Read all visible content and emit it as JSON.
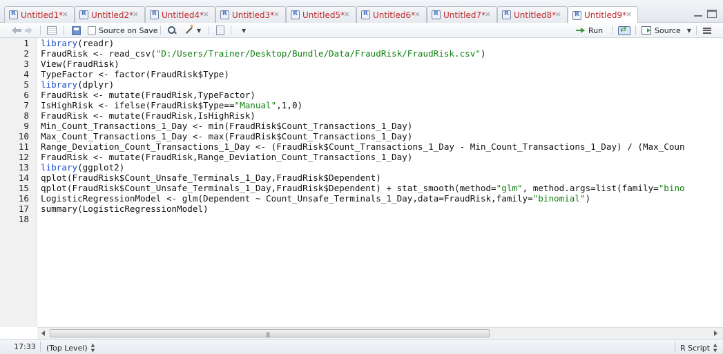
{
  "tabs": [
    {
      "label": "Untitled1*",
      "active": false
    },
    {
      "label": "Untitled2*",
      "active": false
    },
    {
      "label": "Untitled4*",
      "active": false
    },
    {
      "label": "Untitled3*",
      "active": false
    },
    {
      "label": "Untitled5*",
      "active": false
    },
    {
      "label": "Untitled6*",
      "active": false
    },
    {
      "label": "Untitled7*",
      "active": false
    },
    {
      "label": "Untitled8*",
      "active": false
    },
    {
      "label": "Untitled9*",
      "active": true
    }
  ],
  "toolbar": {
    "source_on_save_label": "Source on Save",
    "source_on_save_checked": false,
    "run_label": "Run",
    "source_label": "Source"
  },
  "editor": {
    "lines": [
      {
        "n": "1",
        "tokens": [
          {
            "t": "library",
            "c": "kw"
          },
          {
            "t": "(readr)"
          }
        ]
      },
      {
        "n": "2",
        "tokens": [
          {
            "t": "FraudRisk <- read_csv("
          },
          {
            "t": "\"D:/Users/Trainer/Desktop/Bundle/Data/FraudRisk/FraudRisk.csv\"",
            "c": "str"
          },
          {
            "t": ")"
          }
        ]
      },
      {
        "n": "3",
        "tokens": [
          {
            "t": "View(FraudRisk)"
          }
        ]
      },
      {
        "n": "4",
        "tokens": [
          {
            "t": "TypeFactor <- factor(FraudRisk$Type)"
          }
        ]
      },
      {
        "n": "5",
        "tokens": [
          {
            "t": "library",
            "c": "kw"
          },
          {
            "t": "(dplyr)"
          }
        ]
      },
      {
        "n": "6",
        "tokens": [
          {
            "t": "FraudRisk <- mutate(FraudRisk,TypeFactor)"
          }
        ]
      },
      {
        "n": "7",
        "tokens": [
          {
            "t": "IsHighRisk <- ifelse(FraudRisk$Type=="
          },
          {
            "t": "\"Manual\"",
            "c": "str"
          },
          {
            "t": ",1,0)"
          }
        ]
      },
      {
        "n": "8",
        "tokens": [
          {
            "t": "FraudRisk <- mutate(FraudRisk,IsHighRisk)"
          }
        ]
      },
      {
        "n": "9",
        "tokens": [
          {
            "t": "Min_Count_Transactions_1_Day <- min(FraudRisk$Count_Transactions_1_Day)"
          }
        ]
      },
      {
        "n": "10",
        "tokens": [
          {
            "t": "Max_Count_Transactions_1_Day <- max(FraudRisk$Count_Transactions_1_Day)"
          }
        ]
      },
      {
        "n": "11",
        "tokens": [
          {
            "t": "Range_Deviation_Count_Transactions_1_Day <- (FraudRisk$Count_Transactions_1_Day - Min_Count_Transactions_1_Day) / (Max_Coun"
          }
        ]
      },
      {
        "n": "12",
        "tokens": [
          {
            "t": "FraudRisk <- mutate(FraudRisk,Range_Deviation_Count_Transactions_1_Day)"
          }
        ]
      },
      {
        "n": "13",
        "tokens": [
          {
            "t": "library",
            "c": "kw"
          },
          {
            "t": "(ggplot2)"
          }
        ]
      },
      {
        "n": "14",
        "tokens": [
          {
            "t": "qplot(FraudRisk$Count_Unsafe_Terminals_1_Day,FraudRisk$Dependent)"
          }
        ]
      },
      {
        "n": "15",
        "tokens": [
          {
            "t": "qplot(FraudRisk$Count_Unsafe_Terminals_1_Day,FraudRisk$Dependent) + stat_smooth(method="
          },
          {
            "t": "\"glm\"",
            "c": "str"
          },
          {
            "t": ", method.args=list(family="
          },
          {
            "t": "\"bino",
            "c": "str"
          }
        ]
      },
      {
        "n": "16",
        "tokens": [
          {
            "t": "LogisticRegressionModel <- glm(Dependent ~ Count_Unsafe_Terminals_1_Day,data=FraudRisk,family="
          },
          {
            "t": "\"binomial\"",
            "c": "str"
          },
          {
            "t": ")"
          }
        ]
      },
      {
        "n": "17",
        "tokens": [
          {
            "t": "summary(LogisticRegressionModel)"
          }
        ]
      },
      {
        "n": "18",
        "tokens": []
      }
    ]
  },
  "status": {
    "position": "17:33",
    "level": "(Top Level)",
    "language": "R Script"
  }
}
